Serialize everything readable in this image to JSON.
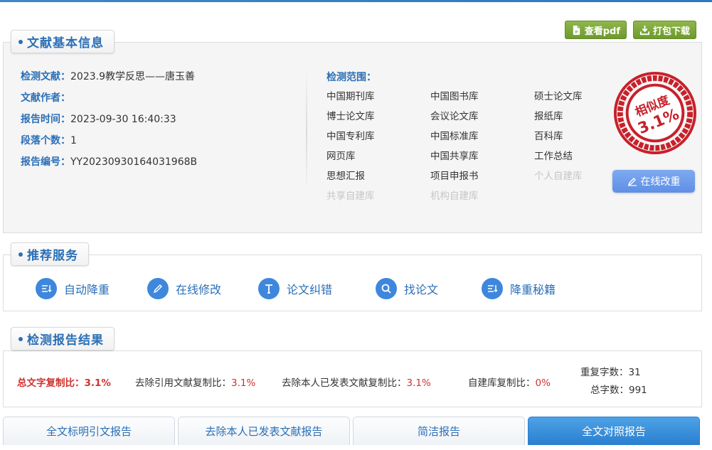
{
  "toolbar": {
    "view_pdf": "查看pdf",
    "download": "打包下载"
  },
  "info": {
    "title": "文献基本信息",
    "rows": [
      {
        "label": "检测文献：",
        "value": "2023.9教学反思——唐玉善"
      },
      {
        "label": "文献作者：",
        "value": ""
      },
      {
        "label": "报告时间：",
        "value": "2023-09-30 16:40:33"
      },
      {
        "label": "段落个数：",
        "value": "1"
      },
      {
        "label": "报告编号：",
        "value": "YY20230930164031968B"
      }
    ],
    "scope_label": "检测范围：",
    "scope": [
      {
        "name": "中国期刊库",
        "enabled": true
      },
      {
        "name": "中国图书库",
        "enabled": true
      },
      {
        "name": "硕士论文库",
        "enabled": true
      },
      {
        "name": "博士论文库",
        "enabled": true
      },
      {
        "name": "会议论文库",
        "enabled": true
      },
      {
        "name": "报纸库",
        "enabled": true
      },
      {
        "name": "中国专利库",
        "enabled": true
      },
      {
        "name": "中国标准库",
        "enabled": true
      },
      {
        "name": "百科库",
        "enabled": true
      },
      {
        "name": "网页库",
        "enabled": true
      },
      {
        "name": "中国共享库",
        "enabled": true
      },
      {
        "name": "工作总结",
        "enabled": true
      },
      {
        "name": "思想汇报",
        "enabled": true
      },
      {
        "name": "项目申报书",
        "enabled": true
      },
      {
        "name": "个人自建库",
        "enabled": false
      },
      {
        "name": "共享自建库",
        "enabled": false
      },
      {
        "name": "机构自建库",
        "enabled": false
      }
    ],
    "stamp_text": "相似度",
    "stamp_value": "3.1%",
    "rewrite_button": "在线改重"
  },
  "recommend": {
    "title": "推荐服务",
    "items": [
      "自动降重",
      "在线修改",
      "论文纠错",
      "找论文",
      "降重秘籍"
    ]
  },
  "result": {
    "title": "检测报告结果",
    "total_label": "总文字复制比：",
    "total_value": "3.1%",
    "exclude_ref_label": "去除引用文献复制比：",
    "exclude_ref_value": "3.1%",
    "exclude_self_label": "去除本人已发表文献复制比：",
    "exclude_self_value": "3.1%",
    "selfbuilt_label": "自建库复制比：",
    "selfbuilt_value": "0%",
    "repeat_label": "重复字数：",
    "repeat_value": "31",
    "total_words_label": "总字数：",
    "total_words_value": "991"
  },
  "tabs": [
    {
      "label": "全文标明引文报告",
      "active": false
    },
    {
      "label": "去除本人已发表文献报告",
      "active": false
    },
    {
      "label": "简洁报告",
      "active": false
    },
    {
      "label": "全文对照报告",
      "active": true
    }
  ],
  "colors": {
    "accent": "#2b6fb6",
    "stamp_red": "#c8202a",
    "button_green": "#7aa63a",
    "tab_active": "#3a8fdb",
    "red_value": "#d0312d"
  }
}
